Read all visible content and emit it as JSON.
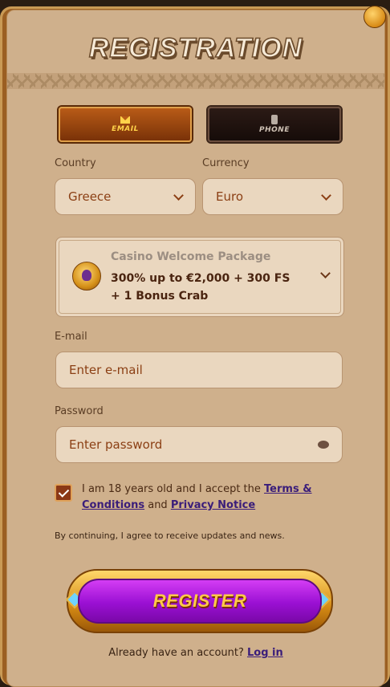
{
  "header": {
    "title": "REGISTRATION"
  },
  "tabs": [
    {
      "label": "EMAIL",
      "icon": "mail-icon",
      "active": true
    },
    {
      "label": "PHONE",
      "icon": "phone-icon",
      "active": false
    }
  ],
  "country": {
    "label": "Country",
    "value": "Greece"
  },
  "currency": {
    "label": "Currency",
    "value": "Euro"
  },
  "bonus": {
    "title": "Casino Welcome Package",
    "offer": "300% up to €2,000 + 300 FS + 1 Bonus Crab"
  },
  "email": {
    "label": "E-mail",
    "placeholder": "Enter e-mail"
  },
  "password": {
    "label": "Password",
    "placeholder": "Enter password"
  },
  "terms": {
    "checked": true,
    "text_pre": "I am 18 years old and I accept the ",
    "terms_link": "Terms & Conditions",
    "text_mid": " and ",
    "privacy_link": "Privacy Notice"
  },
  "notice": "By continuing, I agree to receive updates and news.",
  "register_label": "REGISTER",
  "footer": {
    "text": "Already have an account? ",
    "login_link": "Log in"
  },
  "colors": {
    "accent": "#9a10d3",
    "panel": "#cfb08c",
    "brand_text": "#8b3f14"
  }
}
